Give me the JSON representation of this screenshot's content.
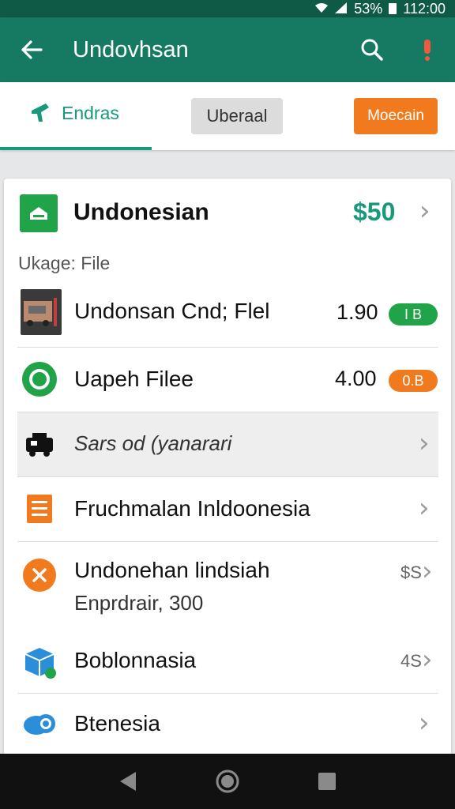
{
  "status_bar": {
    "battery": "53%",
    "time": "112:00"
  },
  "app_bar": {
    "title": "Undovhsan"
  },
  "tabs": [
    {
      "label": "Endras"
    },
    {
      "label": "Uberaal"
    },
    {
      "label": "Moecain"
    }
  ],
  "header": {
    "title": "Undonesian",
    "price": "$50"
  },
  "section_label": "Ukage: File",
  "rows": [
    {
      "label": "Undonsan Cnd; Flel",
      "value": "1.90",
      "badge": "I B",
      "badge_color": "#21a349"
    },
    {
      "label": "Uapeh Filee",
      "value": "4.00",
      "badge": "0.B",
      "badge_color": "#f27a1e"
    },
    {
      "label": "Sars od (yanarari"
    },
    {
      "label": "Fruchmalan Inldoonesia"
    },
    {
      "label": "Undonehan lindsiah",
      "sublabel": "Enprdrair, 300",
      "value": "$S"
    },
    {
      "label": "Boblonnasia",
      "value": "4S"
    },
    {
      "label": "Btenesia"
    }
  ],
  "colors": {
    "primary": "#167a62",
    "accent": "#18997c",
    "orange": "#f27a1e",
    "green": "#21a349"
  }
}
